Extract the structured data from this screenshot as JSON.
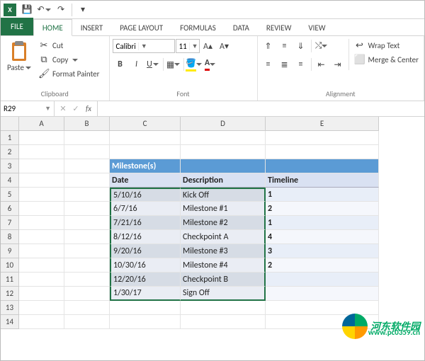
{
  "qat": {
    "save_icon": "💾",
    "undo_icon": "↶",
    "redo_icon": "↷",
    "customize_icon": "▾"
  },
  "tabs": {
    "file": "FILE",
    "home": "HOME",
    "insert": "INSERT",
    "page_layout": "PAGE LAYOUT",
    "formulas": "FORMULAS",
    "data": "DATA",
    "review": "REVIEW",
    "view": "VIEW"
  },
  "ribbon": {
    "clipboard": {
      "label": "Clipboard",
      "paste": "Paste",
      "cut": "Cut",
      "copy": "Copy",
      "format_painter": "Format Painter"
    },
    "font": {
      "label": "Font",
      "name": "Calibri",
      "size": "11",
      "bold": "B",
      "italic": "I",
      "underline": "U"
    },
    "alignment": {
      "label": "Alignment",
      "wrap_text": "Wrap Text",
      "merge_center": "Merge & Center"
    }
  },
  "formula_bar": {
    "name_box": "R29",
    "fx": "fx",
    "value": ""
  },
  "grid": {
    "columns": [
      "A",
      "B",
      "C",
      "D",
      "E"
    ],
    "row_count": 14,
    "title": "Milestone(s)",
    "headers": {
      "date": "Date",
      "desc": "Description",
      "timeline": "Timeline"
    },
    "rows": [
      {
        "c": "5/10/16",
        "d": "Kick Off",
        "e": "1"
      },
      {
        "c": "6/7/16",
        "d": "Milestone #1",
        "e": "2"
      },
      {
        "c": "7/21/16",
        "d": "Milestone #2",
        "e": "1"
      },
      {
        "c": "8/12/16",
        "d": "Checkpoint A",
        "e": "4"
      },
      {
        "c": "9/20/16",
        "d": "Milestone #3",
        "e": "3"
      },
      {
        "c": "10/30/16",
        "d": "Milestone #4",
        "e": "2"
      },
      {
        "c": "12/20/16",
        "d": "Checkpoint B",
        "e": ""
      },
      {
        "c": "1/30/17",
        "d": "Sign Off",
        "e": ""
      }
    ]
  },
  "watermark": {
    "text": "河东软件园",
    "url": "www.pc0359.cn"
  },
  "chart_data": {
    "type": "table",
    "title": "Milestone(s)",
    "columns": [
      "Date",
      "Description",
      "Timeline"
    ],
    "rows": [
      [
        "5/10/16",
        "Kick Off",
        1
      ],
      [
        "6/7/16",
        "Milestone #1",
        2
      ],
      [
        "7/21/16",
        "Milestone #2",
        1
      ],
      [
        "8/12/16",
        "Checkpoint A",
        4
      ],
      [
        "9/20/16",
        "Milestone #3",
        3
      ],
      [
        "10/30/16",
        "Milestone #4",
        2
      ],
      [
        "12/20/16",
        "Checkpoint B",
        null
      ],
      [
        "1/30/17",
        "Sign Off",
        null
      ]
    ]
  }
}
